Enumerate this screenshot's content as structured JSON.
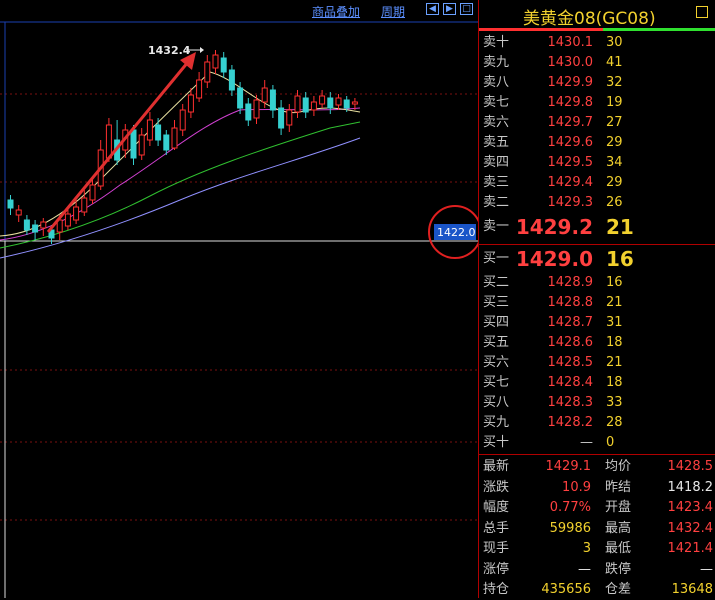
{
  "toolbar": {
    "overlay_label": "商品叠加",
    "period_label": "周期"
  },
  "chart": {
    "high_marker": "1432.4",
    "price_tag": "1422.0"
  },
  "panel": {
    "title": "美黄金08(GC08)"
  },
  "order_book": {
    "asks": [
      {
        "label": "卖十",
        "price": "1430.1",
        "vol": "30"
      },
      {
        "label": "卖九",
        "price": "1430.0",
        "vol": "41"
      },
      {
        "label": "卖八",
        "price": "1429.9",
        "vol": "32"
      },
      {
        "label": "卖七",
        "price": "1429.8",
        "vol": "19"
      },
      {
        "label": "卖六",
        "price": "1429.7",
        "vol": "27"
      },
      {
        "label": "卖五",
        "price": "1429.6",
        "vol": "29"
      },
      {
        "label": "卖四",
        "price": "1429.5",
        "vol": "34"
      },
      {
        "label": "卖三",
        "price": "1429.4",
        "vol": "29"
      },
      {
        "label": "卖二",
        "price": "1429.3",
        "vol": "26"
      },
      {
        "label": "卖一",
        "price": "1429.2",
        "vol": "21"
      }
    ],
    "bids": [
      {
        "label": "买一",
        "price": "1429.0",
        "vol": "16"
      },
      {
        "label": "买二",
        "price": "1428.9",
        "vol": "16"
      },
      {
        "label": "买三",
        "price": "1428.8",
        "vol": "21"
      },
      {
        "label": "买四",
        "price": "1428.7",
        "vol": "31"
      },
      {
        "label": "买五",
        "price": "1428.6",
        "vol": "18"
      },
      {
        "label": "买六",
        "price": "1428.5",
        "vol": "21"
      },
      {
        "label": "买七",
        "price": "1428.4",
        "vol": "18"
      },
      {
        "label": "买八",
        "price": "1428.3",
        "vol": "33"
      },
      {
        "label": "买九",
        "price": "1428.2",
        "vol": "28"
      },
      {
        "label": "买十",
        "price": "—",
        "vol": "0"
      }
    ]
  },
  "stats": [
    {
      "l1": "最新",
      "v1": "1429.1",
      "l2": "均价",
      "v2": "1428.5"
    },
    {
      "l1": "涨跌",
      "v1": "10.9",
      "l2": "昨结",
      "v2": "1418.2"
    },
    {
      "l1": "幅度",
      "v1": "0.77%",
      "l2": "开盘",
      "v2": "1423.4"
    },
    {
      "l1": "总手",
      "v1": "59986",
      "l2": "最高",
      "v2": "1432.4"
    },
    {
      "l1": "现手",
      "v1": "3",
      "l2": "最低",
      "v2": "1421.4"
    },
    {
      "l1": "涨停",
      "v1": "—",
      "l2": "跌停",
      "v2": "—"
    },
    {
      "l1": "持仓",
      "v1": "435656",
      "l2": "仓差",
      "v2": "13648"
    }
  ],
  "colors": {
    "up": "#ff3030",
    "down": "#36d0d0",
    "ask_price": "#ff4040",
    "volume": "#f2d12e",
    "accent": "#5b8fff"
  }
}
